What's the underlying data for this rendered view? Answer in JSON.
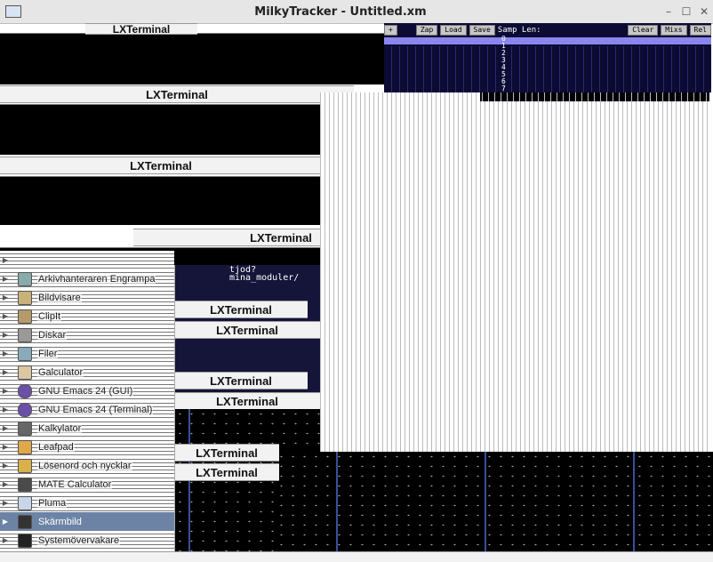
{
  "window": {
    "title": "MilkyTracker - Untitled.xm",
    "controls": {
      "minimize": "–",
      "maximize": "☐",
      "close": "✕"
    }
  },
  "terminal_windows": {
    "title": "LXTerminal"
  },
  "milkytracker": {
    "buttons": [
      "+",
      "Zap",
      "Load",
      "Save"
    ],
    "sample_label": "Samp Len:",
    "right_buttons": [
      "Clear",
      "Mixs",
      "Rel"
    ],
    "sample_digits": "01234567"
  },
  "terminal_text": {
    "line1": "tjod?",
    "line2": "mina_moduler/"
  },
  "menu": {
    "items": [
      {
        "label": "",
        "icon": "blank-icon"
      },
      {
        "label": "Arkivhanteraren Engrampa",
        "icon": "archive-icon"
      },
      {
        "label": "Bildvisare",
        "icon": "image-viewer-icon"
      },
      {
        "label": "ClipIt",
        "icon": "clipboard-icon"
      },
      {
        "label": "Diskar",
        "icon": "disk-icon"
      },
      {
        "label": "Filer",
        "icon": "file-manager-icon"
      },
      {
        "label": "Galculator",
        "icon": "calculator-icon"
      },
      {
        "label": "GNU Emacs 24 (GUI)",
        "icon": "emacs-icon"
      },
      {
        "label": "GNU Emacs 24 (Terminal)",
        "icon": "emacs-icon"
      },
      {
        "label": "Kalkylator",
        "icon": "calculator-icon"
      },
      {
        "label": "Leafpad",
        "icon": "text-editor-icon"
      },
      {
        "label": "Lösenord och nycklar",
        "icon": "keys-icon"
      },
      {
        "label": "MATE Calculator",
        "icon": "calculator-icon"
      },
      {
        "label": "Pluma",
        "icon": "text-editor-icon"
      },
      {
        "label": "Skärmbild",
        "icon": "screenshot-icon"
      },
      {
        "label": "Systemövervakare",
        "icon": "system-monitor-icon"
      }
    ],
    "selected_label": "Skärmbild"
  },
  "colors": {
    "menu_selected": "#6c83a6",
    "tracker_bg": "#0b0b33",
    "tracker_accent": "#8a86ef"
  }
}
